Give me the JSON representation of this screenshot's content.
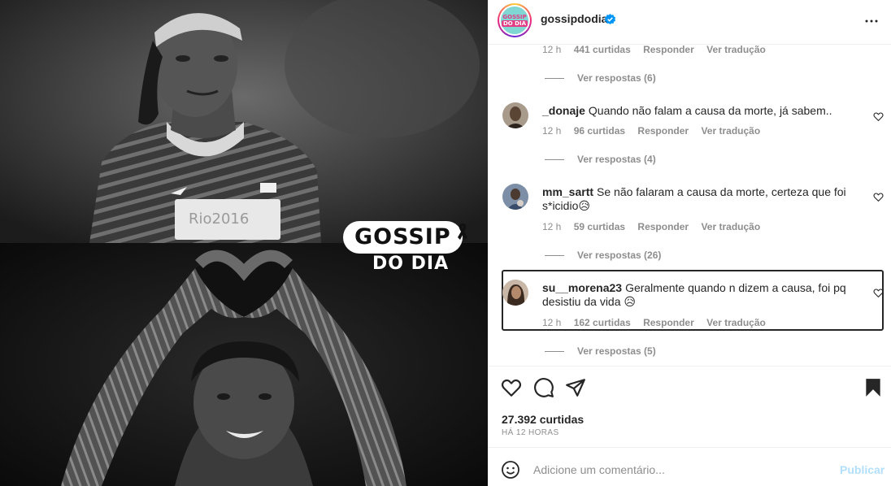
{
  "media": {
    "logo_word1": "GOSSIP",
    "logo_word2": "DO DIA",
    "ribbon_icon": "black-ribbon-icon"
  },
  "post": {
    "username": "gossipdodia",
    "avatar_text_1": "GOSSIP",
    "avatar_text_2": "DO DIA",
    "verified": true,
    "accent": "#0095f6"
  },
  "comments": [
    {
      "time": "12 h",
      "likes": "441 curtidas",
      "reply": "Responder",
      "translate": "Ver tradução",
      "view_replies": "Ver respostas (6)"
    },
    {
      "username": "_donaje",
      "text": "Quando não falam a causa da morte, já sabem..",
      "time": "12 h",
      "likes": "96 curtidas",
      "reply": "Responder",
      "translate": "Ver tradução",
      "view_replies": "Ver respostas (4)"
    },
    {
      "username": "mm_sartt",
      "text": "Se não falaram a causa da morte, certeza que foi s*icidio😥",
      "time": "12 h",
      "likes": "59 curtidas",
      "reply": "Responder",
      "translate": "Ver tradução",
      "view_replies": "Ver respostas (26)"
    },
    {
      "username": "su__morena23",
      "text": "Geralmente quando n dizem a causa, foi pq desistiu da vida 😥",
      "time": "12 h",
      "likes": "162 curtidas",
      "reply": "Responder",
      "translate": "Ver tradução",
      "view_replies": "Ver respostas (5)"
    }
  ],
  "actions": {
    "likes_count": "27.392 curtidas",
    "time_ago": "HÁ 12 HORAS"
  },
  "add_comment": {
    "placeholder": "Adicione um comentário...",
    "publish": "Publicar",
    "publish_color": "#b2dffc"
  }
}
